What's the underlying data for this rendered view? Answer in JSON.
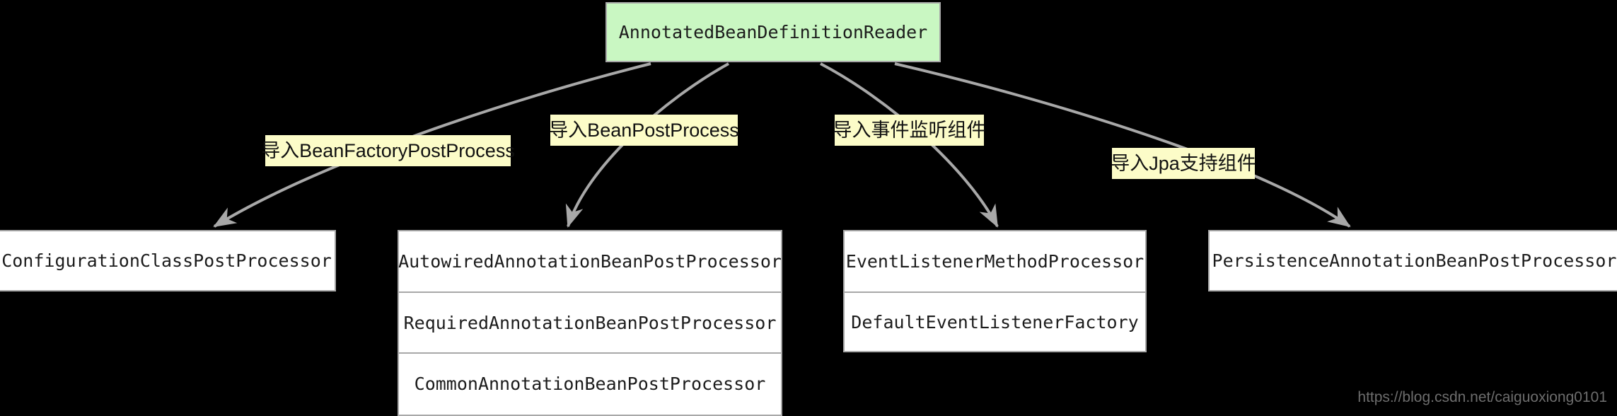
{
  "diagram": {
    "background_color": "#000000",
    "edge_color": "#a8a8a8",
    "root_fill": "#c9f7c2",
    "node_fill": "#ffffff",
    "label_fill": "#fcfcc8",
    "root": {
      "title": "AnnotatedBeanDefinitionReader"
    },
    "edge_labels": [
      {
        "text": "导入BeanFactoryPostProcess"
      },
      {
        "text": "导入BeanPostProcess"
      },
      {
        "text": "导入事件监听组件"
      },
      {
        "text": "导入Jpa支持组件"
      }
    ],
    "targets": [
      {
        "name": "configuration-class-post-processor-node",
        "rows": [
          "ConfigurationClassPostProcessor"
        ]
      },
      {
        "name": "bean-post-processor-node",
        "rows": [
          "AutowiredAnnotationBeanPostProcessor",
          "RequiredAnnotationBeanPostProcessor",
          "CommonAnnotationBeanPostProcessor"
        ]
      },
      {
        "name": "event-listener-node",
        "rows": [
          "EventListenerMethodProcessor",
          "DefaultEventListenerFactory"
        ]
      },
      {
        "name": "persistence-node",
        "rows": [
          "PersistenceAnnotationBeanPostProcessor"
        ]
      }
    ],
    "watermark": "https://blog.csdn.net/caiguoxiong0101"
  }
}
